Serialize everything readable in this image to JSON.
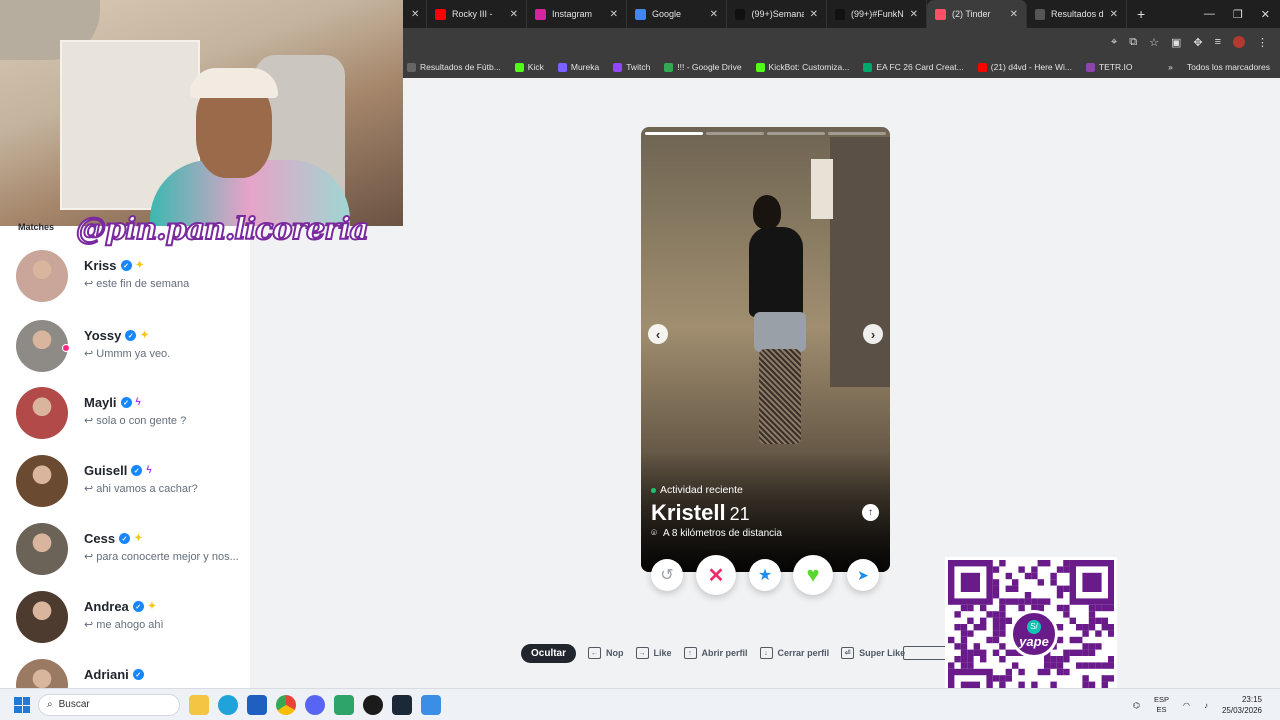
{
  "browser": {
    "tabs": [
      {
        "label": "",
        "color": "#202124"
      },
      {
        "label": "Rocky III -",
        "color": "#ff0000"
      },
      {
        "label": "Instagram",
        "color": "#d6249f"
      },
      {
        "label": "Google",
        "color": "#4285f4"
      },
      {
        "label": "(99+)Semana",
        "color": "#111111"
      },
      {
        "label": "(99+)#FunkNo",
        "color": "#111111"
      },
      {
        "label": "(2) Tinder",
        "color": "#fd5068"
      },
      {
        "label": "Resultados de",
        "color": "#555555"
      }
    ],
    "new_tab": "+",
    "bookmarks": [
      {
        "label": "Resultados de Fútb...",
        "color": "#666666"
      },
      {
        "label": "Kick",
        "color": "#53fc18"
      },
      {
        "label": "Mureka",
        "color": "#7b61ff"
      },
      {
        "label": "Twitch",
        "color": "#9146ff"
      },
      {
        "label": "!!! - Google Drive",
        "color": "#34a853"
      },
      {
        "label": "KickBot: Customiza...",
        "color": "#53fc18"
      },
      {
        "label": "EA FC 26 Card Creat...",
        "color": "#00a86b"
      },
      {
        "label": "(21) d4vd - Here Wi...",
        "color": "#ff0000"
      },
      {
        "label": "TETR.IO",
        "color": "#8e44ad"
      }
    ],
    "bookmarks_more": "»",
    "all_bookmarks": "Todos los marcadores"
  },
  "webcam": {
    "handle": "@pin.pan.licoreria"
  },
  "sidebar": {
    "section_label": "Matches",
    "matches": [
      {
        "name": "Kriss",
        "message": "este fin de semana",
        "badge": "✦",
        "badge_color": "#f5c518",
        "avatar": "#c9a59a",
        "online": false
      },
      {
        "name": "Yossy",
        "message": "Ummm ya veo.",
        "badge": "✦",
        "badge_color": "#f5c518",
        "avatar": "#8e8a86",
        "online": true
      },
      {
        "name": "Mayli",
        "message": "sola o con gente ?",
        "badge": "ϟ",
        "badge_color": "#a238ff",
        "avatar": "#b34a4a",
        "online": false
      },
      {
        "name": "Guisell",
        "message": "ahi vamos a cachar?",
        "badge": "ϟ",
        "badge_color": "#a238ff",
        "avatar": "#6a4a30",
        "online": false
      },
      {
        "name": "Cess",
        "message": "para conocerte mejor y nos...",
        "badge": "✦",
        "badge_color": "#f5c518",
        "avatar": "#6b6358",
        "online": false
      },
      {
        "name": "Andrea",
        "message": "me ahogo ahì",
        "badge": "✦",
        "badge_color": "#f5c518",
        "avatar": "#4e3b30",
        "online": false
      },
      {
        "name": "Adriani",
        "message": "",
        "badge": "",
        "badge_color": "#f5c518",
        "avatar": "#9a7a62",
        "online": false
      }
    ]
  },
  "profile": {
    "activity": "Actividad reciente",
    "name": "Kristell",
    "age": "21",
    "distance": "A 8 kilómetros de distancia",
    "photo_count": 4,
    "photo_index": 0
  },
  "actions": {
    "rewind_icon": "↺",
    "nope_icon": "✕",
    "superlike_icon": "★",
    "like_icon": "♥",
    "boost_icon": "➤"
  },
  "shortcuts": {
    "hide": "Ocultar",
    "items": [
      {
        "key": "←",
        "label": "Nop"
      },
      {
        "key": "→",
        "label": "Like"
      },
      {
        "key": "↑",
        "label": "Abrir perfil"
      },
      {
        "key": "↓",
        "label": "Cerrar perfil"
      },
      {
        "key": "⏎",
        "label": "Super Like"
      }
    ]
  },
  "qr": {
    "brand": "yape",
    "currency": "S/",
    "color": "#6a1b8a"
  },
  "taskbar": {
    "search": "Buscar",
    "lang_top": "ESP",
    "lang_bottom": "ES",
    "time": "23:15",
    "date": "25/03/2026"
  }
}
